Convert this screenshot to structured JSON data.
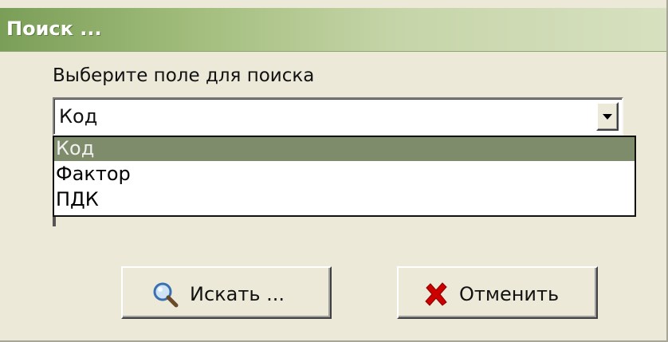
{
  "window": {
    "title": "Поиск ..."
  },
  "search_field": {
    "label": "Выберите поле для поиска",
    "selected_value": "Код",
    "options": [
      "Код",
      "Фактор",
      "ПДК"
    ],
    "highlighted_index": 0
  },
  "buttons": {
    "search_label": "Искать ...",
    "cancel_label": "Отменить",
    "search_icon": "magnifier-icon",
    "cancel_icon": "red-x-icon"
  },
  "colors": {
    "title_bar": "#7a9e57",
    "selection": "#7f8c6b",
    "cancel_icon": "#cc0000"
  }
}
